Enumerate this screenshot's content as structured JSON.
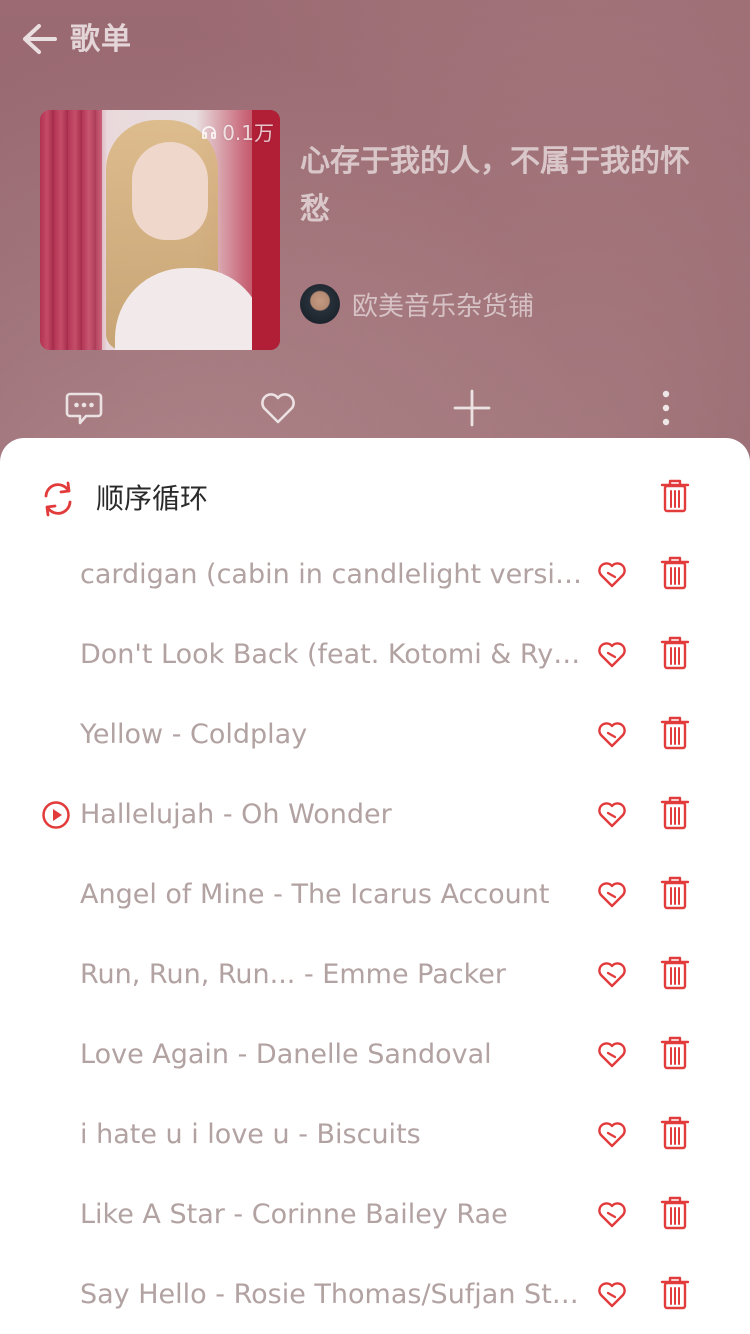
{
  "header": {
    "title": "歌单"
  },
  "playlist": {
    "title": "心存于我的人，不属于我的怀愁",
    "play_count": "0.1万",
    "creator": "欧美音乐杂货铺"
  },
  "colors": {
    "accent": "#e23b3b",
    "song_text": "#b2a2a2",
    "mode_text": "#2a2a2a",
    "sheet_background": "#ffffff"
  },
  "queue": {
    "play_mode": "顺序循环",
    "songs": [
      {
        "title": "cardigan (cabin in candlelight version) - Taylor Swift",
        "current": false
      },
      {
        "title": "Don't Look Back (feat. Kotomi & Ryan Elder)",
        "current": false
      },
      {
        "title": "Yellow - Coldplay",
        "current": false
      },
      {
        "title": "Hallelujah - Oh Wonder",
        "current": true
      },
      {
        "title": "Angel of Mine - The Icarus Account",
        "current": false
      },
      {
        "title": "Run, Run, Run... - Emme Packer",
        "current": false
      },
      {
        "title": "Love Again - Danelle Sandoval",
        "current": false
      },
      {
        "title": "i hate u i love u - Biscuits",
        "current": false
      },
      {
        "title": "Like A Star - Corinne Bailey Rae",
        "current": false
      },
      {
        "title": "Say Hello - Rosie Thomas/Sufjan Stevens",
        "current": false
      }
    ]
  },
  "icons": {
    "back": "arrow-left-icon",
    "headphones": "headphones-icon",
    "comment": "comment-icon",
    "favorite": "heart-outline-icon",
    "add": "plus-icon",
    "more": "more-vertical-icon",
    "repeat": "repeat-icon",
    "delete": "trash-icon",
    "playing": "play-circle-icon"
  }
}
